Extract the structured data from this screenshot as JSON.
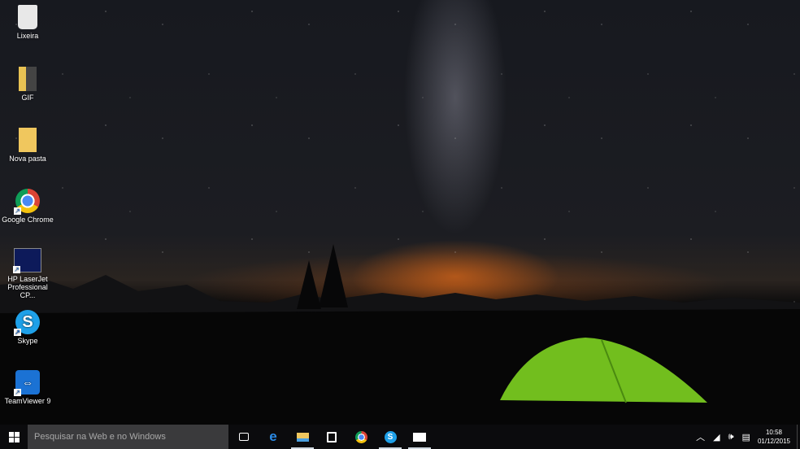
{
  "desktop_icons": [
    {
      "label": "Lixeira",
      "icon": "recycle-bin-icon"
    },
    {
      "label": "GIF",
      "icon": "folder-icon"
    },
    {
      "label": "Nova pasta",
      "icon": "folder-icon"
    },
    {
      "label": "Google Chrome",
      "icon": "chrome-icon"
    },
    {
      "label": "HP LaserJet Professional CP...",
      "icon": "hp-printer-icon"
    },
    {
      "label": "Skype",
      "icon": "skype-icon"
    },
    {
      "label": "TeamViewer 9",
      "icon": "teamviewer-icon"
    }
  ],
  "taskbar": {
    "search_placeholder": "Pesquisar na Web e no Windows",
    "apps": [
      "task-view",
      "edge",
      "file-explorer",
      "store",
      "chrome",
      "skype",
      "mail"
    ],
    "tray": {
      "time": "10:58",
      "date": "01/12/2015"
    }
  }
}
